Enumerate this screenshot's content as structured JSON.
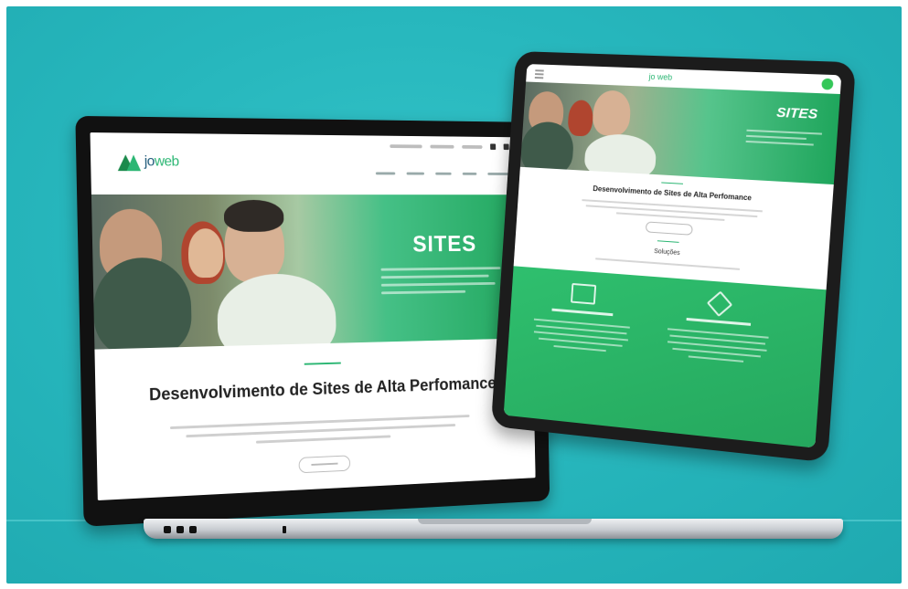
{
  "laptop": {
    "logo_prefix": "jo",
    "logo_suffix": "web",
    "hero_title": "SITES",
    "heading": "Desenvolvimento de Sites de Alta Perfomance"
  },
  "tablet": {
    "logo": "jo web",
    "hero_title": "SITES",
    "heading": "Desenvolvimento de Sites de Alta Perfomance",
    "subheading": "Soluções"
  },
  "colors": {
    "background": "#27b7bd",
    "brand_green": "#2bb673",
    "device_frame": "#111111"
  },
  "icons": [
    "menu-icon",
    "whatsapp-icon",
    "layout-icon",
    "house-icon"
  ]
}
